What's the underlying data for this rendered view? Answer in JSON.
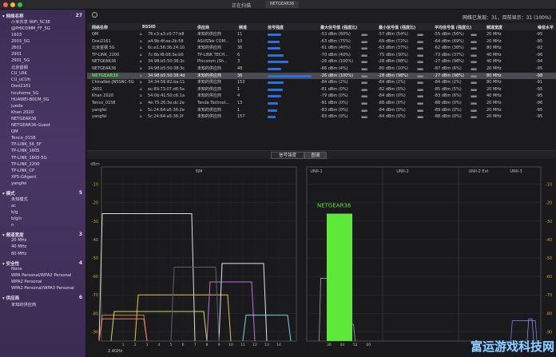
{
  "window": {
    "title": "正在扫描",
    "ssid": "NETGEAR36"
  },
  "colors": {
    "accent": "#2f6fe0",
    "selected_series": "#5ee83a"
  },
  "toolbar": {
    "search_icon": "search-icon",
    "status": "网络已发现：31，目前显示：31 (100%)"
  },
  "sidebar": {
    "sections": [
      {
        "label": "网络名称",
        "count": "27",
        "items": [
          "小米共享 WiFi_5C3E",
          "@PHICOMM_FF_5G",
          "1603",
          "2003_5G",
          "2601",
          "2901",
          "2901_5G",
          "北京首钢",
          "CU_LRK",
          "CU_uCUh",
          "Dosi2161",
          "houhome_5G",
          "HUAWEI-B0CM_5G",
          "jueda",
          "Khan 2020",
          "NETGEAR36",
          "NETGEAR36-Guest",
          "QM",
          "Tenco_0158",
          "TP-LINK_56_5F",
          "TP-LINK_1605",
          "TP-LINK_1605-5G",
          "TP-LINK_2200",
          "TP-LINK_CP",
          "XPS-GAgent",
          "yangfei"
        ]
      },
      {
        "label": "模式",
        "count": "5",
        "items": [
          "未知模式",
          "ac",
          "b/g",
          "b/g/n",
          "n"
        ]
      },
      {
        "label": "频道宽度",
        "count": "3",
        "items": [
          "20 MHz",
          "40 MHz",
          "80 MHz"
        ]
      },
      {
        "label": "安全性",
        "count": "4",
        "items": [
          "None",
          "WPA Personal/WPA2 Personal",
          "WPA2 Personal",
          "WPA2 Personal/WPA3 Personal"
        ]
      },
      {
        "label": "供应商",
        "count": "6",
        "items": [
          "未知的供应商"
        ]
      }
    ]
  },
  "table": {
    "headers": [
      "网络名称",
      "BSSID",
      "供应商",
      "频道",
      "信号强度",
      "最大信号值 (强度比)",
      "最小信号值 (强度比)",
      "平均信号值 (强度比)",
      "频道宽度",
      "噪音水平"
    ],
    "rows": [
      {
        "name": "QM",
        "bssid": "76:c3:a3:c0:77:b8",
        "vendor": "未知的供应商",
        "channel": "11",
        "level": 0.3,
        "max": "-53 dBm (60%)",
        "min": "-57 dBm (54%)",
        "avg": "-55 dBm (56%)",
        "width": "20 MHz",
        "noise": "-95"
      },
      {
        "name": "Dosi2161",
        "bssid": "a4:9b:4f:ee:2b:58",
        "vendor": "ASUSTek COM...",
        "channel": "10",
        "level": 0.25,
        "max": "-63 dBm (75%)",
        "min": "-69 dBm (72%)",
        "avg": "-64 dBm (69%)",
        "width": "20 MHz",
        "noise": "-95"
      },
      {
        "name": "北京首钢 5G",
        "bssid": "6c:e1:56:36:24:10",
        "vendor": "未知的供应商",
        "channel": "36",
        "level": 0.28,
        "max": "-61 dBm (40%)",
        "min": "-63 dBm (37%)",
        "avg": "-62 dBm (38%)",
        "width": "80 MHz",
        "noise": "-92"
      },
      {
        "name": "TP-LINK_2200",
        "bssid": "7c:6b:f8:08:3e:b0",
        "vendor": "TP-LINK TECH...",
        "channel": "6",
        "level": 0.35,
        "max": "-70 dBm (40%)",
        "min": "-75 dBm (30%)",
        "avg": "-73 dBm (37%)",
        "width": "40 MHz",
        "noise": "-96"
      },
      {
        "name": "NETGEAR36",
        "bssid": "34:98:b5:50:38:3c",
        "vendor": "Phicomm (Sh...",
        "channel": "3",
        "level": 0.45,
        "max": "-26 dBm (100%)",
        "min": "-28 dBm (98%)",
        "avg": "-27 dBm (98%)",
        "width": "40 MHz",
        "noise": "-94"
      },
      {
        "name": "NETGEAR36",
        "bssid": "34:98:b5:50:38:3c",
        "vendor": "未知的供应商",
        "channel": "48",
        "level": 0.3,
        "max": "-86 dBm (4%)",
        "min": "-80 dBm (10%)",
        "avg": "-87 dBm (6%)",
        "width": "20 MHz",
        "noise": "-95"
      },
      {
        "name": "NETGEAR36",
        "bssid": "34:98:b5:50:38:4d",
        "vendor": "未知的供应商",
        "channel": "36",
        "level": 0.95,
        "max": "-26 dBm (100%)",
        "min": "-28 dBm (98%)",
        "avg": "-27 dBm (98%)",
        "width": "80 MHz",
        "noise": "-98"
      },
      {
        "name": "ChinaNet-JN5SNC-5G",
        "bssid": "34:34:56:82:ba:11",
        "vendor": "未知的供应商",
        "channel": "153",
        "level": 0.35,
        "max": "-84 dBm (2%)",
        "min": "-84 dBm (2%)",
        "avg": "-84 dBm (2%)",
        "width": "80 MHz",
        "noise": "-91"
      },
      {
        "name": "2601",
        "bssid": "ec:89:73:07:d6:5a",
        "vendor": "未知的供应商",
        "channel": "1",
        "level": 0.32,
        "max": "-81 dBm (0%)",
        "min": "-82 dBm (0%)",
        "avg": "-85 dBm (5%)",
        "width": "20 MHz",
        "noise": "-95"
      },
      {
        "name": "Khan 2020",
        "bssid": "54:0b:41:50:c6:1a",
        "vendor": "未知的供应商",
        "channel": "4",
        "level": 0.3,
        "max": "-79 dBm (0%)",
        "min": "-84 dBm (0%)",
        "avg": "-83 dBm (6%)",
        "width": "40 MHz",
        "noise": "-95"
      },
      {
        "name": "Tenco_0158",
        "bssid": "4e:75:26:3e:dc:2e",
        "vendor": "Tenda Technol...",
        "channel": "13",
        "level": 0.22,
        "max": "-81 dBm (0%)",
        "min": "-88 dBm (0%)",
        "avg": "-88 dBm (0%)",
        "width": "20 MHz",
        "noise": "-96"
      },
      {
        "name": "yangfei",
        "bssid": "5c:24:64:a5:36:2e",
        "vendor": "未知的供应商",
        "channel": "1",
        "level": 0.2,
        "max": "-83 dBm (0%)",
        "min": "-84 dBm (0%)",
        "avg": "-89 dBm (0%)",
        "width": "20 MHz",
        "noise": "-95"
      },
      {
        "name": "yangfei",
        "bssid": "5c:24:64:a5:36:2f",
        "vendor": "未知的供应商",
        "channel": "157",
        "level": 0.18,
        "max": "-83 dBm (0%)",
        "min": "-84 dBm (0%)",
        "avg": "-88 dBm (0%)",
        "width": "20 MHz",
        "noise": "-95"
      }
    ]
  },
  "tabs": [
    "信号强度",
    "图谱"
  ],
  "chart_data": {
    "type": "area",
    "panels": [
      "ISM",
      "UNII-1",
      "UNII-2",
      "UNII-2 Ext",
      "UNII-3"
    ],
    "band_labels": [
      "2.4GHz",
      "5GHz"
    ],
    "ylabel": "dBm",
    "yticks": [
      "-10",
      "-20",
      "-30",
      "-40",
      "-50",
      "-60",
      "-70",
      "-80",
      "-90"
    ],
    "ylim": [
      -95,
      -5
    ],
    "xticks_24": [
      "1",
      "2",
      "3",
      "4",
      "5",
      "6",
      "7",
      "8",
      "9",
      "10",
      "11",
      "12",
      "13",
      "14"
    ],
    "xticks_5": [
      "36",
      "44",
      "52",
      "60"
    ],
    "highlight": {
      "name": "NETGEAR36",
      "channel": 36,
      "width_mhz": 80,
      "dbm": -26
    },
    "series_24": [
      {
        "center": 3,
        "width": 40,
        "dbm": -26,
        "color": "#dddddd"
      },
      {
        "center": 6,
        "width": 40,
        "dbm": -70,
        "color": "#e0c850"
      },
      {
        "center": 11,
        "width": 20,
        "dbm": -53,
        "color": "#e6e6e6"
      },
      {
        "center": 10,
        "width": 20,
        "dbm": -63,
        "color": "#c070d8"
      },
      {
        "center": 1,
        "width": 20,
        "dbm": -81,
        "color": "#d67a30"
      },
      {
        "center": 4,
        "width": 40,
        "dbm": -79,
        "color": "#c8e060"
      },
      {
        "center": 13,
        "width": 20,
        "dbm": -81,
        "color": "#7ad0e0"
      },
      {
        "center": 1,
        "width": 20,
        "dbm": -83,
        "color": "#e08080"
      },
      {
        "center": 7,
        "width": 20,
        "dbm": -55,
        "color": "#5c5c70"
      }
    ],
    "series_5": [
      {
        "center": 36,
        "width": 80,
        "dbm": -61,
        "color": "#a0a0a0"
      },
      {
        "center": 48,
        "width": 20,
        "dbm": -86,
        "color": "#a0a0a0"
      },
      {
        "center": 153,
        "width": 80,
        "dbm": -84,
        "color": "#6a7ae8"
      },
      {
        "center": 157,
        "width": 20,
        "dbm": -83,
        "color": "#8a8ae8"
      }
    ]
  },
  "watermark": "富运游戏科技网"
}
